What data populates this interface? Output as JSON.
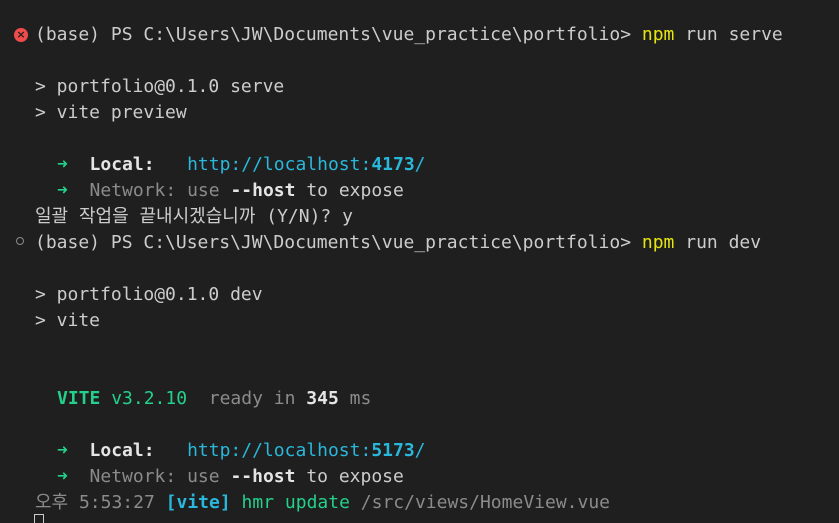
{
  "colors": {
    "background": "#1f1f1f",
    "foreground": "#cccccc",
    "npm_yellow": "#e5e510",
    "green": "#23d18b",
    "cyan": "#29b8db",
    "dim": "#8b8b8b",
    "error_red": "#f14c4c"
  },
  "decorations": {
    "error_icon": "x-circle-icon",
    "idle_icon": "circle-outline-icon"
  },
  "cmd1": {
    "prompt": "(base) PS C:\\Users\\JW\\Documents\\vue_practice\\portfolio> ",
    "npm": "npm",
    "args": " run serve"
  },
  "out1": {
    "script_line": "> portfolio@0.1.0 serve",
    "cmd_line": "> vite preview",
    "local_arrow": "➜",
    "local_label": "Local:",
    "local_url_prefix": "http://localhost:",
    "local_url_port": "4173",
    "local_url_suffix": "/",
    "network_arrow": "➜",
    "network_label": "Network:",
    "network_use": "use",
    "network_flag_prefix": "--",
    "network_flag": "host",
    "network_rest": "to expose",
    "batch_prompt": "일괄 작업을 끝내시겠습니까 (Y/N)? y"
  },
  "cmd2": {
    "prompt": "(base) PS C:\\Users\\JW\\Documents\\vue_practice\\portfolio> ",
    "npm": "npm",
    "args": " run dev"
  },
  "out2": {
    "script_line": "> portfolio@0.1.0 dev",
    "cmd_line": "> vite",
    "vite_name": "VITE",
    "vite_version": "v3.2.10",
    "ready_prefix": "ready in",
    "ready_ms": "345",
    "ready_unit": "ms",
    "local_arrow": "➜",
    "local_label": "Local:",
    "local_url_prefix": "http://localhost:",
    "local_url_port": "5173",
    "local_url_suffix": "/",
    "network_arrow": "➜",
    "network_label": "Network:",
    "network_use": "use",
    "network_flag_prefix": "--",
    "network_flag": "host",
    "network_rest": "to expose",
    "hmr_time": "오후 5:53:27",
    "hmr_tag": "[vite]",
    "hmr_msg": "hmr update",
    "hmr_path": "/src/views/HomeView.vue"
  }
}
